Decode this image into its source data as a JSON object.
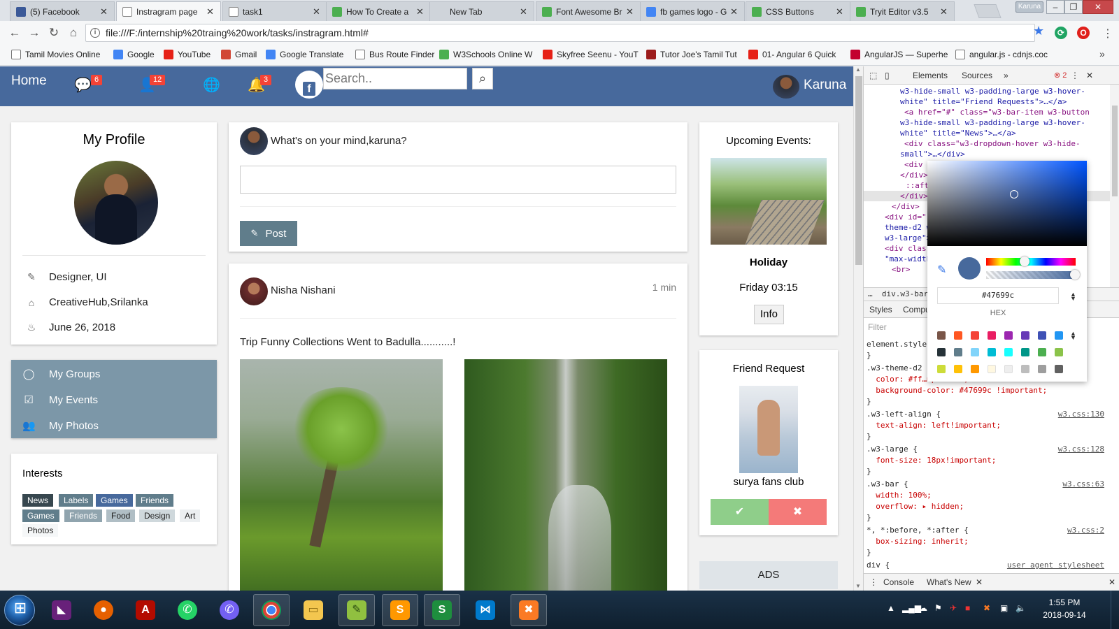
{
  "browser": {
    "tabs": [
      {
        "title": "(5) Facebook",
        "color": "#3b5998"
      },
      {
        "title": "Instragram page",
        "color": "#ffffff",
        "active": true
      },
      {
        "title": "task1",
        "color": "#ffffff"
      },
      {
        "title": "How To Create a",
        "color": "#4caf50"
      },
      {
        "title": "New Tab",
        "color": ""
      },
      {
        "title": "Font Awesome Br",
        "color": "#4caf50"
      },
      {
        "title": "fb games logo - G",
        "color": "#4285f4"
      },
      {
        "title": "CSS Buttons",
        "color": "#4caf50"
      },
      {
        "title": "Tryit Editor v3.5",
        "color": "#4caf50"
      }
    ],
    "profile_chip": "Karuna",
    "url": "file:///F:/internship%20traing%20work/tasks/instragram.html#",
    "bookmarks": [
      {
        "label": "Tamil Movies Online",
        "color": "#ffffff"
      },
      {
        "label": "Google",
        "color": "#4285f4"
      },
      {
        "label": "YouTube",
        "color": "#e62117"
      },
      {
        "label": "Gmail",
        "color": "#d14836"
      },
      {
        "label": "Google Translate",
        "color": "#4285f4"
      },
      {
        "label": "Bus Route Finder",
        "color": "#ffffff"
      },
      {
        "label": "W3Schools Online W",
        "color": "#4caf50"
      },
      {
        "label": "Skyfree Seenu - YouT",
        "color": "#e62117"
      },
      {
        "label": "Tutor Joe's Tamil Tut",
        "color": "#9c1c1c"
      },
      {
        "label": "01- Angular 6 Quick",
        "color": "#e62117"
      },
      {
        "label": "AngularJS — Superhe",
        "color": "#c3002f"
      },
      {
        "label": "angular.js - cdnjs.coc",
        "color": "#ffffff"
      }
    ]
  },
  "nav": {
    "home": "Home",
    "messages_badge": "6",
    "friends_badge": "12",
    "notifications_badge": "3",
    "search_placeholder": "Search..",
    "user": "Karuna",
    "theme_color": "#47699c"
  },
  "profile": {
    "title": "My Profile",
    "role": "Designer, UI",
    "location": "CreativeHub,Srilanka",
    "birthday": "June 26, 2018"
  },
  "menu": {
    "groups": "My Groups",
    "events": "My Events",
    "photos": "My Photos"
  },
  "interests": {
    "title": "Interests",
    "tags": [
      {
        "label": "News",
        "style": "dark"
      },
      {
        "label": "Labels",
        "style": "mid"
      },
      {
        "label": "Games",
        "style": "theme"
      },
      {
        "label": "Friends",
        "style": "mid"
      },
      {
        "label": "Games",
        "style": "mid"
      },
      {
        "label": "Friends",
        "style": "light"
      },
      {
        "label": "Food",
        "style": "pale"
      },
      {
        "label": "Design",
        "style": "pale2"
      },
      {
        "label": "Art",
        "style": "pale3"
      },
      {
        "label": "Photos",
        "style": "white"
      }
    ]
  },
  "composer": {
    "prompt": "What's on your mind,karuna?",
    "post_button": "Post"
  },
  "feed_post": {
    "author": "Nisha Nishani",
    "time": "1 min",
    "text": "Trip Funny Collections Went to Badulla...........!"
  },
  "events": {
    "title": "Upcoming Events:",
    "name": "Holiday",
    "date": "Friday 03:15",
    "info_button": "Info"
  },
  "friend_request": {
    "title": "Friend Request",
    "name": "surya fans club"
  },
  "ads": "ADS",
  "devtools": {
    "tabs": [
      "Elements",
      "Sources"
    ],
    "error_count": "2",
    "dom_lines": [
      "w3-hide-small w3-padding-large w3-hover-",
      "white\" title=\"Friend Requests\">…</a>",
      "<a href=\"#\" class=\"w3-bar-item w3-button",
      "w3-hide-small w3-padding-large w3-hover-",
      "white\" title=\"News\">…</a>",
      "<div class=\"w3-dropdown-hover w3-hide-",
      "small\">…</div>",
      "<div c",
      "</div>",
      "::afte",
      "</div>",
      "</div>",
      "<div id=\"",
      "theme-d2 w3",
      "w3-large\">",
      "<div clas",
      "\"max-width:",
      "<br>"
    ],
    "breadcrumb": "div.w3-bar.w",
    "style_tabs": [
      "Styles",
      "Compu"
    ],
    "filter_placeholder": "Filter",
    "rules": [
      {
        "text": "element.style {",
        "kind": "sel"
      },
      {
        "text": "}",
        "kind": "sel"
      },
      {
        "text": ".w3-theme-d2 {",
        "kind": "sel"
      },
      {
        "text": "  color: #ff…mp. cant;",
        "kind": "prop"
      },
      {
        "text": "  background-color: #47699c !important;",
        "kind": "prop"
      },
      {
        "text": "}",
        "kind": "sel"
      },
      {
        "text": ".w3-left-align {",
        "kind": "sel",
        "src": "w3.css:130"
      },
      {
        "text": "  text-align: left!important;",
        "kind": "prop"
      },
      {
        "text": "}",
        "kind": "sel"
      },
      {
        "text": ".w3-large {",
        "kind": "sel",
        "src": "w3.css:128"
      },
      {
        "text": "  font-size: 18px!important;",
        "kind": "prop"
      },
      {
        "text": "}",
        "kind": "sel"
      },
      {
        "text": ".w3-bar {",
        "kind": "sel",
        "src": "w3.css:63"
      },
      {
        "text": "  width: 100%;",
        "kind": "prop"
      },
      {
        "text": "  overflow: ▸ hidden;",
        "kind": "prop"
      },
      {
        "text": "}",
        "kind": "sel"
      },
      {
        "text": "*, *:before, *:after {",
        "kind": "sel",
        "src": "w3.css:2"
      },
      {
        "text": "  box-sizing: inherit;",
        "kind": "prop"
      },
      {
        "text": "}",
        "kind": "sel"
      },
      {
        "text": "div {",
        "kind": "sel",
        "src": "user agent stylesheet"
      }
    ],
    "bottom_tabs": [
      "Console",
      "What's New"
    ],
    "picker": {
      "hex": "#47699c",
      "format": "HEX",
      "palette": [
        "#795548",
        "#ff5722",
        "#f44336",
        "#e91e63",
        "#9c27b0",
        "#673ab7",
        "#3f51b5",
        "#2196f3",
        "#263238",
        "#607d8b",
        "#81d4fa",
        "#00bcd4",
        "#18ffff",
        "#009688",
        "#4caf50",
        "#8bc34a",
        "#cddc39",
        "#ffc107",
        "#ff9800",
        "#fff8e1",
        "#eeeeee",
        "#bdbdbd",
        "#9e9e9e",
        "#616161"
      ]
    }
  },
  "taskbar": {
    "time": "1:55 PM",
    "date": "2018-09-14"
  }
}
